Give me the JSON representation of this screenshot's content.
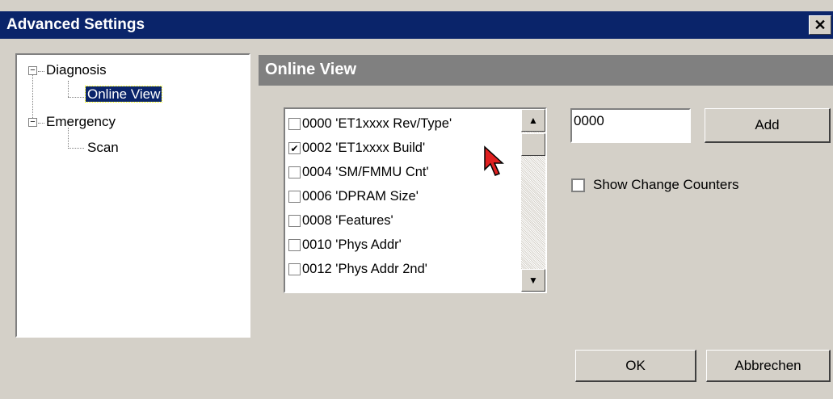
{
  "window": {
    "title": "Advanced Settings",
    "close_label": "✕"
  },
  "tree": {
    "items": [
      {
        "label": "Diagnosis",
        "expander": "−"
      },
      {
        "label": "Online View"
      },
      {
        "label": "Emergency",
        "expander": "−"
      },
      {
        "label": "Scan"
      }
    ]
  },
  "panel": {
    "header": "Online View"
  },
  "register_list": {
    "items": [
      {
        "label": "0000 'ET1xxxx Rev/Type'",
        "checked": false
      },
      {
        "label": "0002 'ET1xxxx Build'",
        "checked": true
      },
      {
        "label": "0004 'SM/FMMU Cnt'",
        "checked": false
      },
      {
        "label": "0006 'DPRAM Size'",
        "checked": false
      },
      {
        "label": "0008 'Features'",
        "checked": false
      },
      {
        "label": "0010 'Phys Addr'",
        "checked": false
      },
      {
        "label": "0012 'Phys Addr 2nd'",
        "checked": false
      }
    ],
    "scroll_up": "▲",
    "scroll_down": "▼"
  },
  "address_input": {
    "value": "0000"
  },
  "buttons": {
    "add": "Add",
    "ok": "OK",
    "cancel": "Abbrechen"
  },
  "show_change_counters": {
    "label": "Show Change Counters",
    "checked": false
  }
}
